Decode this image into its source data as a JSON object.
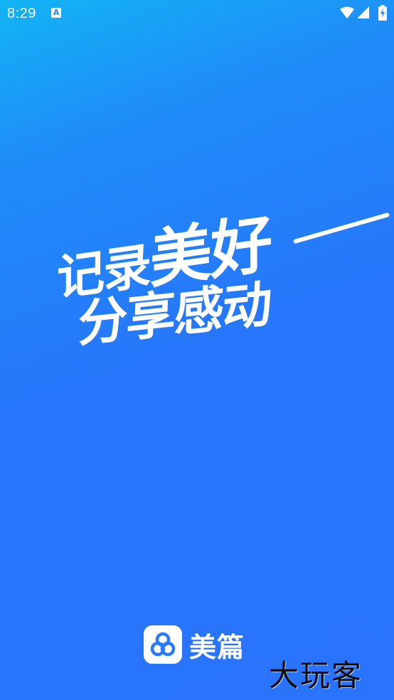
{
  "status_bar": {
    "time": "8:29",
    "notification_icon_label": "A",
    "icons": [
      "wifi-icon",
      "signal-icon",
      "battery-icon"
    ]
  },
  "splash": {
    "slogan_line1_part1": "记录",
    "slogan_line1_part2": "美好",
    "slogan_line2": "分享感动"
  },
  "brand": {
    "name": "美篇",
    "logo_icon": "meipian-logo-icon"
  },
  "watermark": {
    "text": "大玩客"
  },
  "colors": {
    "background_top": "#13b4f5",
    "background_bottom": "#2a73fd",
    "text": "#ffffff"
  }
}
